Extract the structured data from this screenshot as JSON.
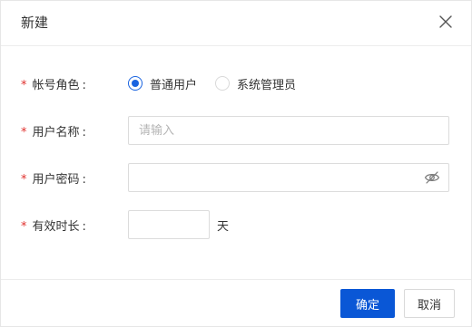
{
  "dialog": {
    "title": "新建",
    "close_icon": "close-icon"
  },
  "form": {
    "account_role": {
      "required_mark": "*",
      "label": "帐号角色",
      "colon": ":",
      "options": [
        {
          "label": "普通用户",
          "checked": true
        },
        {
          "label": "系统管理员",
          "checked": false
        }
      ]
    },
    "username": {
      "required_mark": "*",
      "label": "用户名称",
      "colon": ":",
      "value": "",
      "placeholder": "请输入"
    },
    "password": {
      "required_mark": "*",
      "label": "用户密码",
      "colon": ":",
      "value": "",
      "toggle_icon": "eye-hidden-icon"
    },
    "validity": {
      "required_mark": "*",
      "label": "有效时长",
      "colon": ":",
      "value": "",
      "unit": "天"
    }
  },
  "footer": {
    "confirm_label": "确定",
    "cancel_label": "取消"
  },
  "colors": {
    "primary": "#0a57d6",
    "required": "#e0302d",
    "radio_checked": "#1a64e0"
  }
}
